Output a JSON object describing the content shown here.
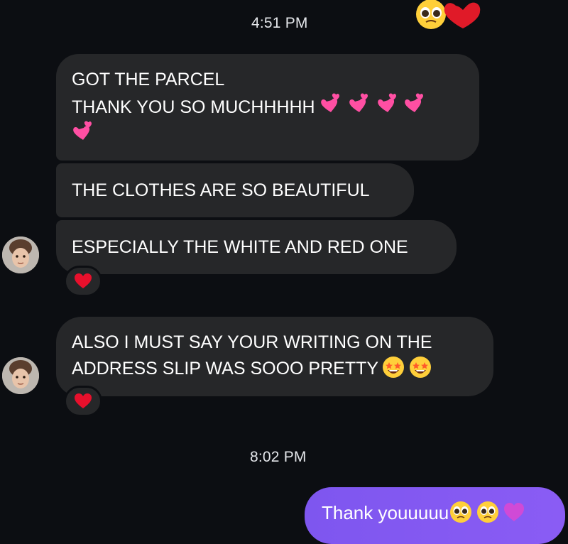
{
  "thread": {
    "timestamps": [
      "4:51 PM",
      "8:02 PM"
    ]
  },
  "incoming": {
    "msg1_line1": "GOT THE PARCEL",
    "msg1_line2": "THANK YOU SO MUCHHHHH",
    "msg2": "THE CLOTHES ARE SO BEAUTIFUL",
    "msg3": "ESPECIALLY THE WHITE AND RED ONE",
    "msg4_line1": "ALSO I MUST SAY YOUR WRITING ON THE",
    "msg4_line2": "ADDRESS SLIP WAS SOOO PRETTY"
  },
  "outgoing": {
    "msg1": "Thank youuuuu"
  },
  "icons": {
    "pleading": "pleading-face-emoji",
    "red_heart": "red-heart-emoji",
    "pink_hearts": "two-hearts-emoji",
    "star_struck": "star-struck-emoji",
    "purple_heart": "purple-heart-emoji"
  },
  "colors": {
    "background": "#0c0e12",
    "incoming_bubble": "#262729",
    "outgoing_bubble": "#7e56ef",
    "reaction_heart": "#e8102c"
  }
}
